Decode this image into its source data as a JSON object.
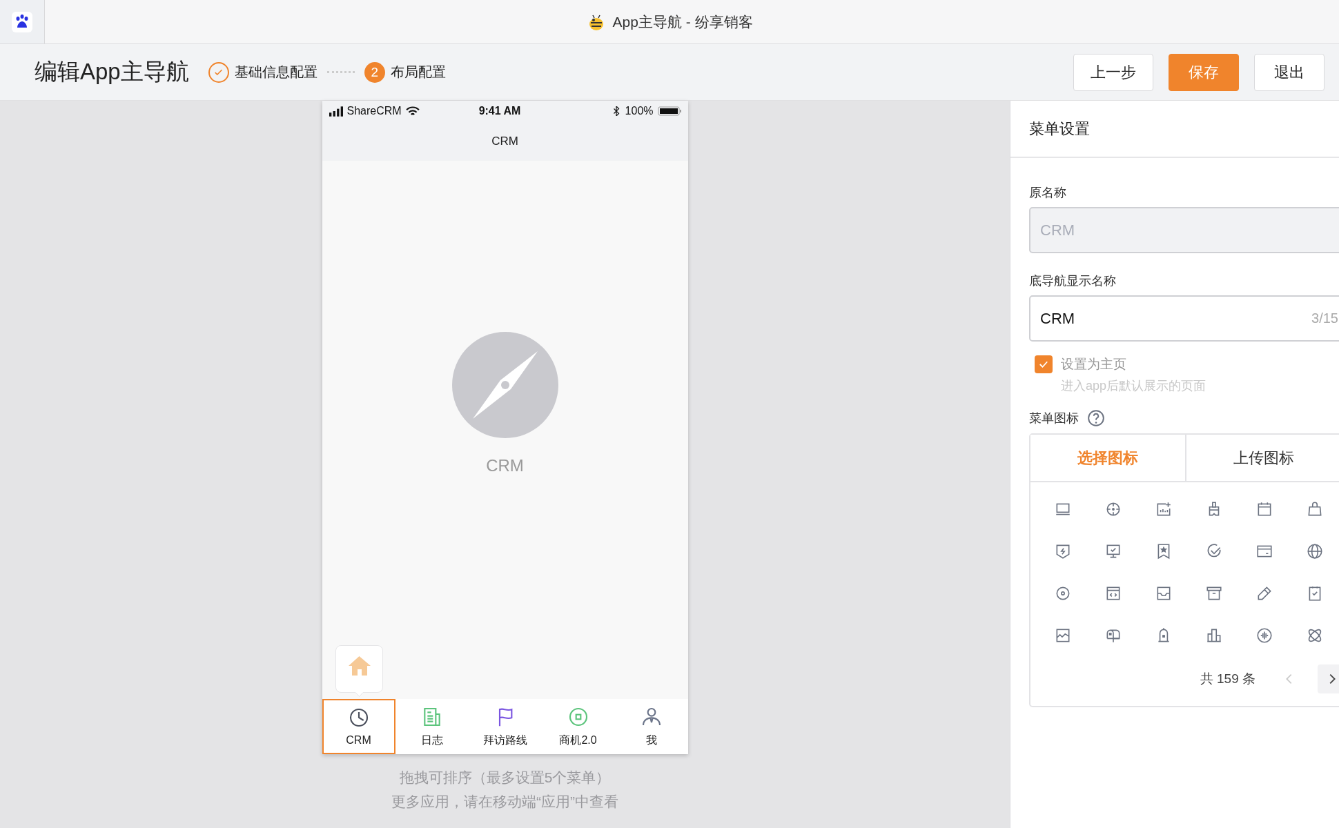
{
  "window": {
    "title": "App主导航 - 纷享销客"
  },
  "header": {
    "title": "编辑App主导航",
    "steps": [
      {
        "label": "基础信息配置",
        "done": true
      },
      {
        "number": "2",
        "label": "布局配置",
        "done": false
      }
    ],
    "buttons": [
      {
        "label": "上一步",
        "kind": "default"
      },
      {
        "label": "保存",
        "kind": "primary"
      },
      {
        "label": "退出",
        "kind": "default"
      }
    ]
  },
  "phone": {
    "status": {
      "carrier": "ShareCRM",
      "time": "9:41 AM",
      "battery": "100%"
    },
    "nav_title": "CRM",
    "page_label": "CRM",
    "tabs": [
      {
        "label": "CRM",
        "color": "#4a4f5c",
        "selected": true
      },
      {
        "label": "日志",
        "color": "#5cc47c",
        "selected": false
      },
      {
        "label": "拜访路线",
        "color": "#7a55e0",
        "selected": false
      },
      {
        "label": "商机2.0",
        "color": "#5cc47c",
        "selected": false
      },
      {
        "label": "我",
        "color": "#6b7489",
        "selected": false
      }
    ]
  },
  "hints": [
    "拖拽可排序（最多设置5个菜单）",
    "更多应用，请在移动端“应用”中查看"
  ],
  "settings": {
    "title": "菜单设置",
    "original_name": {
      "label": "原名称",
      "value": "CRM",
      "disabled": true
    },
    "display_name": {
      "label": "底导航显示名称",
      "value": "CRM",
      "counter": "3/15"
    },
    "homepage": {
      "label": "设置为主页",
      "hint": "进入app后默认展示的页面",
      "checked": true
    },
    "icon_picker": {
      "label": "菜单图标",
      "tabs": [
        {
          "label": "选择图标",
          "selected": true
        },
        {
          "label": "上传图标",
          "selected": false
        }
      ],
      "total": "共 159 条",
      "prev_disabled": true
    }
  }
}
